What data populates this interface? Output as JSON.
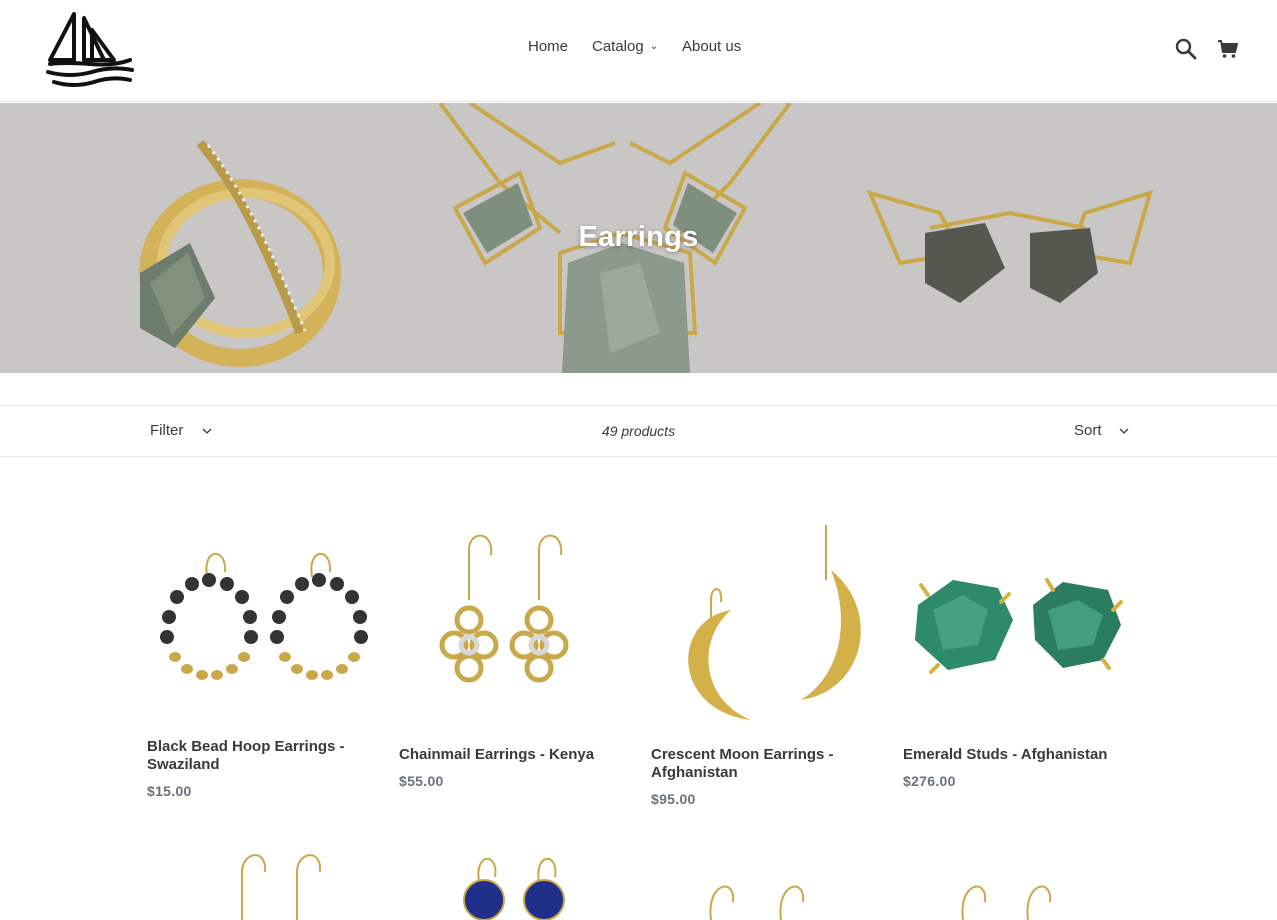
{
  "header": {
    "logo_alt": "sailboat logo",
    "nav": {
      "home": "Home",
      "catalog": "Catalog",
      "about": "About us"
    },
    "search_label": "Submit",
    "cart_label": "Cart"
  },
  "hero": {
    "title": "Earrings"
  },
  "toolbar": {
    "filter_label": "Filter",
    "product_count": "49 products",
    "sort_label": "Sort"
  },
  "products": [
    {
      "title_line1": "Black Bead Hoop Earrings -",
      "title_line2": "Swaziland",
      "price": "$15.00"
    },
    {
      "title_line1": "Chainmail Earrings - Kenya",
      "title_line2": "",
      "price": "$55.00"
    },
    {
      "title_line1": "Crescent Moon Earrings -",
      "title_line2": "Afghanistan",
      "price": "$95.00"
    },
    {
      "title_line1": "Emerald Studs - Afghanistan",
      "title_line2": "",
      "price": "$276.00"
    }
  ],
  "colors": {
    "text": "#3a3a3a",
    "price": "#69727b",
    "hero_bg": "#c8c7c5",
    "border": "#e8e8e1",
    "gold": "#c9a84a"
  }
}
